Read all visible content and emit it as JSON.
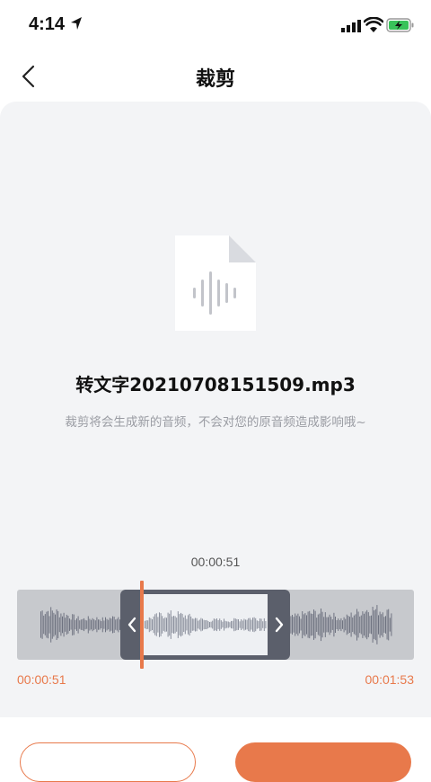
{
  "status": {
    "time": "4:14"
  },
  "nav": {
    "title": "裁剪"
  },
  "file": {
    "name": "转文字20210708151509.mp3",
    "hint": "裁剪将会生成新的音频，不会对您的原音频造成影响哦~"
  },
  "editor": {
    "cursor_time": "00:00:51",
    "start_time": "00:00:51",
    "end_time": "00:01:53"
  },
  "actions": {
    "cancel_label": "",
    "confirm_label": ""
  },
  "colors": {
    "accent": "#e8794b",
    "card_bg": "#f3f4f6",
    "selection_frame": "#5b5f6b"
  }
}
